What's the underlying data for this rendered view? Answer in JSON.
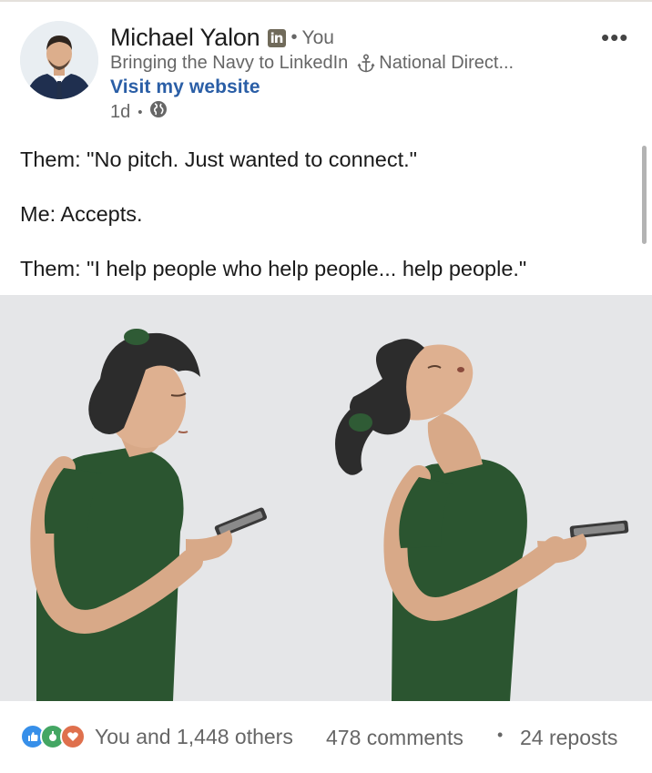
{
  "post": {
    "author": {
      "name": "Michael Yalon",
      "badge": "in",
      "relation": "You",
      "headline": "Bringing the Navy to LinkedIn",
      "headline_icon": "anchor-icon",
      "headline_rest": "National Direct...",
      "website_link": "Visit my website",
      "time": "1d",
      "visibility_icon": "globe-icon"
    },
    "menu_icon": "more-options-icon",
    "lines": [
      "Them: \"No pitch. Just wanted to connect.\"",
      "Me: Accepts.",
      "Them: \"I help people who help people... help people.\""
    ],
    "image_alt": "Woman looking at phone, then leaning head back in exasperation"
  },
  "social": {
    "reactions": [
      "like-icon",
      "celebrate-icon",
      "love-icon"
    ],
    "reactions_text": "You and 1,448 others",
    "comments": "478 comments",
    "reposts": "24 reposts"
  },
  "colors": {
    "link": "#2a5ea6",
    "muted": "#666666",
    "shirt": "#2b5530",
    "image_bg": "#e5e6e8"
  }
}
